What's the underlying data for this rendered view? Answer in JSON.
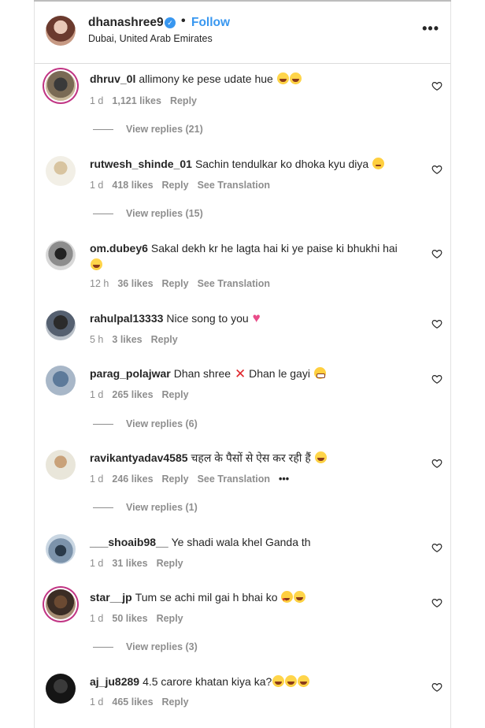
{
  "post": {
    "username": "dhanashree9",
    "separator": "•",
    "follow_label": "Follow",
    "location": "Dubai, United Arab Emirates",
    "more_label": "•••"
  },
  "comments": [
    {
      "username": "dhruv_0l",
      "text": "allimony ke pese udate hue",
      "emojis": [
        "laugh",
        "laugh"
      ],
      "time": "1 d",
      "likes": "1,121 likes",
      "reply": "Reply",
      "translate": "",
      "replies": "View replies (21)"
    },
    {
      "username": "rutwesh_shinde_01",
      "text": "Sachin tendulkar ko dhoka kyu diya",
      "emojis": [
        "tear"
      ],
      "time": "1 d",
      "likes": "418 likes",
      "reply": "Reply",
      "translate": "See Translation",
      "replies": "View replies (15)"
    },
    {
      "username": "om.dubey6",
      "text": "Sakal dekh kr he lagta hai ki ye paise ki bhukhi hai",
      "emojis": [
        "laugh"
      ],
      "time": "12 h",
      "likes": "36 likes",
      "reply": "Reply",
      "translate": "See Translation",
      "replies": ""
    },
    {
      "username": "rahulpal13333",
      "text": "Nice song to you",
      "emojis": [
        "heart"
      ],
      "time": "5 h",
      "likes": "3 likes",
      "reply": "Reply",
      "translate": "",
      "replies": ""
    },
    {
      "username": "parag_polajwar",
      "text": "Dhan shree",
      "text2": "Dhan le gayi",
      "emojis": [
        "grimace"
      ],
      "time": "1 d",
      "likes": "265 likes",
      "reply": "Reply",
      "translate": "",
      "replies": "View replies (6)"
    },
    {
      "username": "ravikantyadav4585",
      "text": "चहल के पैसों से ऐस कर रही हैं",
      "emojis": [
        "laugh"
      ],
      "time": "1 d",
      "likes": "246 likes",
      "reply": "Reply",
      "translate": "See Translation",
      "more": "•••",
      "replies": "View replies (1)"
    },
    {
      "username": "___shoaib98__",
      "text": "Ye shadi wala khel Ganda th",
      "emojis": [],
      "time": "1 d",
      "likes": "31 likes",
      "reply": "Reply",
      "translate": "",
      "replies": ""
    },
    {
      "username": "star__jp",
      "text": "Tum se achi mil gai h bhai ko",
      "emojis": [
        "hearteyes",
        "laugh"
      ],
      "time": "1 d",
      "likes": "50 likes",
      "reply": "Reply",
      "translate": "",
      "replies": "View replies (3)"
    },
    {
      "username": "aj_ju8289",
      "text": "4.5 carore khatan kiya ka?",
      "emojis": [
        "laugh",
        "laugh",
        "laugh"
      ],
      "time": "1 d",
      "likes": "465 likes",
      "reply": "Reply",
      "translate": "",
      "replies": ""
    }
  ],
  "colors": {
    "accent": "#3897f0",
    "muted": "#8e8e8e",
    "text": "#262626",
    "story_ring": "#c13584"
  }
}
